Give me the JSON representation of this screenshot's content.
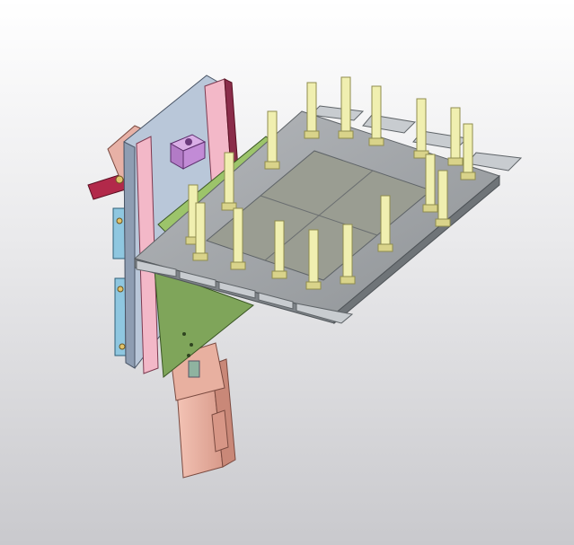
{
  "viewport": {
    "title": "",
    "background_top": "#ffffff",
    "background_bottom": "#c9c9cd"
  },
  "model": {
    "parts": [
      "lifting-column",
      "vertical-mounting-plate",
      "pink-guide-rail",
      "purple-clamp-block",
      "red-base-bracket",
      "blue-slide-brackets",
      "green-triangular-support",
      "gray-fixture-tray",
      "yellow-locating-pins",
      "green-tie-bar"
    ],
    "colors": {
      "tray": "#a9adb1",
      "tray_edge": "#7f8489",
      "tray_tabs": "#c8ccd0",
      "pins": "#f0efb0",
      "pins_edge": "#8f8c4e",
      "pink": "#f3b8c8",
      "red": "#b2294a",
      "purple": "#c28bd6",
      "blue": "#8fc7e0",
      "green": "#7fa55a",
      "column": "#f0b8a8",
      "plate": "#b9c7d9"
    }
  }
}
